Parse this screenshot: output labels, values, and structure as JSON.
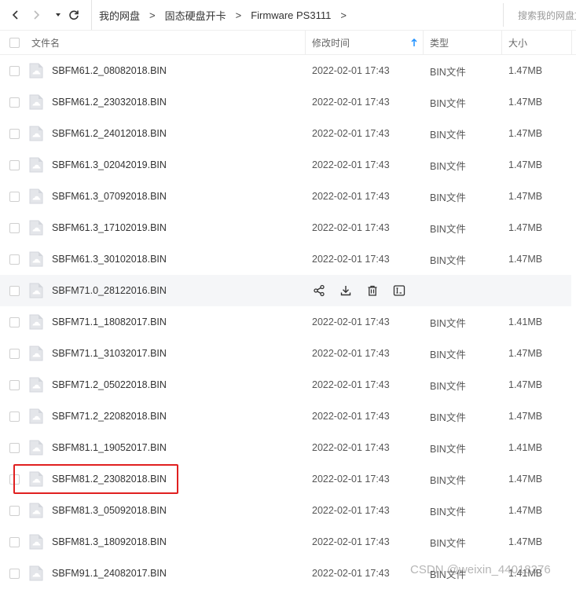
{
  "toolbar": {
    "back_icon": "chevron-left-icon",
    "forward_icon": "chevron-right-icon",
    "history_icon": "caret-down-icon",
    "refresh_icon": "refresh-icon"
  },
  "breadcrumb": [
    {
      "label": "我的网盘"
    },
    {
      "label": "固态硬盘开卡"
    },
    {
      "label": "Firmware PS3111"
    }
  ],
  "breadcrumb_separator": ">",
  "search": {
    "placeholder": "搜索我的网盘文"
  },
  "header": {
    "name": "文件名",
    "modified": "修改时间",
    "type": "类型",
    "size": "大小",
    "sort_icon": "arrow-up-icon"
  },
  "files": [
    {
      "name": "SBFM61.2_08082018.BIN",
      "date": "2022-02-01 17:43",
      "type": "BIN文件",
      "size": "1.47MB"
    },
    {
      "name": "SBFM61.2_23032018.BIN",
      "date": "2022-02-01 17:43",
      "type": "BIN文件",
      "size": "1.47MB"
    },
    {
      "name": "SBFM61.2_24012018.BIN",
      "date": "2022-02-01 17:43",
      "type": "BIN文件",
      "size": "1.47MB"
    },
    {
      "name": "SBFM61.3_02042019.BIN",
      "date": "2022-02-01 17:43",
      "type": "BIN文件",
      "size": "1.47MB"
    },
    {
      "name": "SBFM61.3_07092018.BIN",
      "date": "2022-02-01 17:43",
      "type": "BIN文件",
      "size": "1.47MB"
    },
    {
      "name": "SBFM61.3_17102019.BIN",
      "date": "2022-02-01 17:43",
      "type": "BIN文件",
      "size": "1.47MB"
    },
    {
      "name": "SBFM61.3_30102018.BIN",
      "date": "2022-02-01 17:43",
      "type": "BIN文件",
      "size": "1.47MB"
    },
    {
      "name": "SBFM71.0_28122016.BIN",
      "hover": true
    },
    {
      "name": "SBFM71.1_18082017.BIN",
      "date": "2022-02-01 17:43",
      "type": "BIN文件",
      "size": "1.41MB"
    },
    {
      "name": "SBFM71.1_31032017.BIN",
      "date": "2022-02-01 17:43",
      "type": "BIN文件",
      "size": "1.47MB"
    },
    {
      "name": "SBFM71.2_05022018.BIN",
      "date": "2022-02-01 17:43",
      "type": "BIN文件",
      "size": "1.47MB"
    },
    {
      "name": "SBFM71.2_22082018.BIN",
      "date": "2022-02-01 17:43",
      "type": "BIN文件",
      "size": "1.47MB"
    },
    {
      "name": "SBFM81.1_19052017.BIN",
      "date": "2022-02-01 17:43",
      "type": "BIN文件",
      "size": "1.41MB"
    },
    {
      "name": "SBFM81.2_23082018.BIN",
      "date": "2022-02-01 17:43",
      "type": "BIN文件",
      "size": "1.47MB",
      "highlighted": true
    },
    {
      "name": "SBFM81.3_05092018.BIN",
      "date": "2022-02-01 17:43",
      "type": "BIN文件",
      "size": "1.47MB"
    },
    {
      "name": "SBFM81.3_18092018.BIN",
      "date": "2022-02-01 17:43",
      "type": "BIN文件",
      "size": "1.47MB"
    },
    {
      "name": "SBFM91.1_24082017.BIN",
      "date": "2022-02-01 17:43",
      "type": "BIN文件",
      "size": "1.41MB"
    }
  ],
  "hover_actions": [
    "share-icon",
    "download-icon",
    "delete-icon",
    "rename-icon"
  ],
  "watermark": "CSDN @weixin_44018376",
  "colors": {
    "highlight": "#e02020",
    "sort_arrow": "#1e90ff",
    "hover_bg": "#f5f6f8"
  }
}
